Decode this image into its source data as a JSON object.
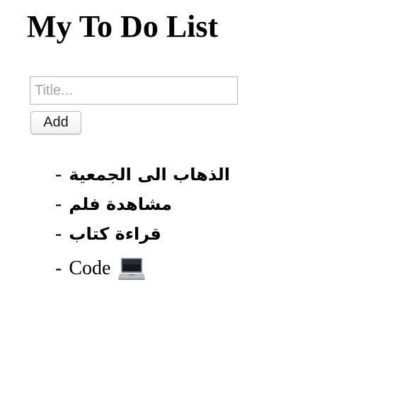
{
  "page": {
    "title": "My To Do List"
  },
  "form": {
    "title_placeholder": "Title...",
    "title_value": "",
    "add_label": "Add"
  },
  "todos": [
    {
      "dash": "-",
      "text": "الذهاب الى الجمعية"
    },
    {
      "dash": "-",
      "text": "مشاهدة فلم"
    },
    {
      "dash": "-",
      "text": "قراءة كتاب"
    },
    {
      "dash": "-",
      "text": "Code",
      "icon": "laptop-icon"
    }
  ]
}
